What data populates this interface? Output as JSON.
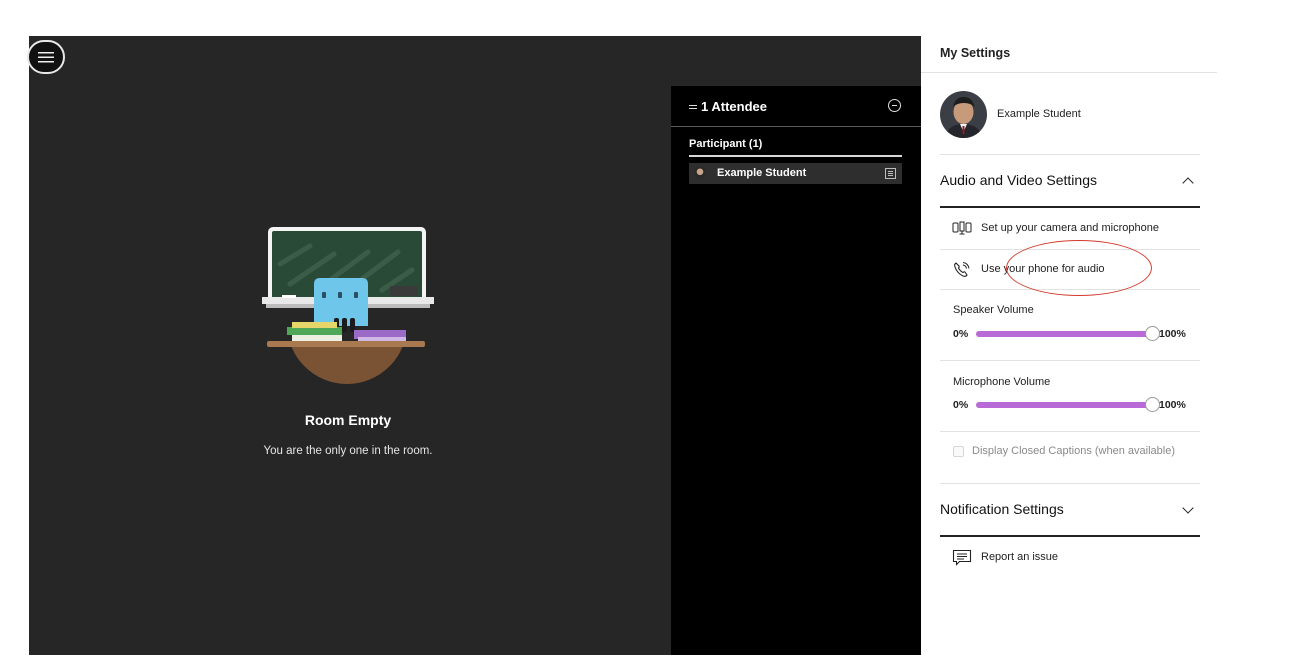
{
  "stage": {
    "room_title": "Room Empty",
    "room_subtitle": "You are the only one in the room."
  },
  "attendees": {
    "title": "1 Attendee",
    "group_label": "Participant (1)",
    "participants": [
      {
        "name": "Example Student"
      }
    ]
  },
  "settings": {
    "title": "My Settings",
    "user_name": "Example Student",
    "audio_video": {
      "label": "Audio and Video Settings",
      "expanded": true,
      "camera_setup_label": "Set up your camera and microphone",
      "phone_audio_label": "Use your phone for audio",
      "speaker": {
        "label": "Speaker Volume",
        "min": "0%",
        "max": "100%",
        "level": 1.0
      },
      "microphone": {
        "label": "Microphone Volume",
        "min": "0%",
        "max": "100%",
        "level": 1.0
      },
      "captions_label": "Display Closed Captions (when available)",
      "captions_checked": false
    },
    "notifications": {
      "label": "Notification Settings",
      "expanded": false
    },
    "report_label": "Report an issue"
  },
  "colors": {
    "stage_bg": "#262626",
    "panel_bg": "#000000",
    "slider_fill": "#b86ad6",
    "highlight": "#d23c2e"
  }
}
